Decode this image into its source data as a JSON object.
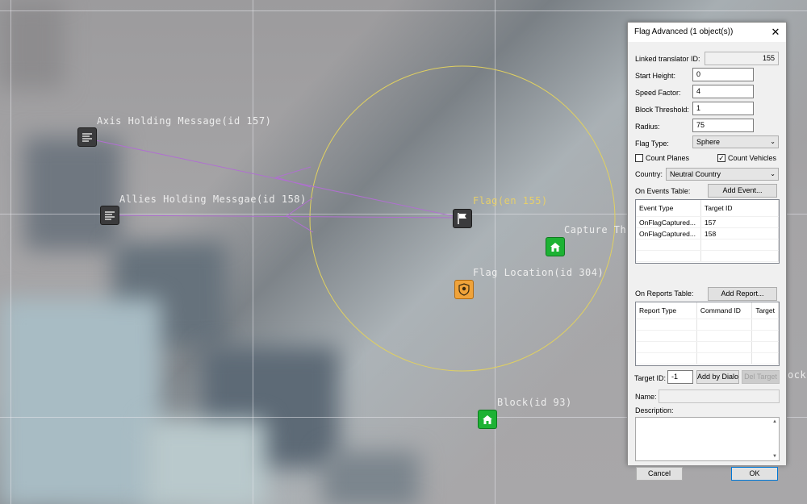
{
  "map": {
    "labels": {
      "axis_msg": "Axis Holding Message(id 157)",
      "allies_msg": "Allies Holding Messgae(id 158)",
      "flag": "Flag(en 155)",
      "capture": "Capture Th",
      "flag_location": "Flag Location(id 304)",
      "block": "Block(id 93)",
      "block_edge": "ock"
    },
    "icons": {
      "axis_msg": "message-icon",
      "allies_msg": "message-icon",
      "flag": "flag-icon",
      "capture": "house-icon",
      "flag_location": "shield-marker-icon",
      "block": "house-icon"
    },
    "colors": {
      "circle": "#e0d060",
      "links": "#b070d0",
      "label_yellow": "#e6cf6a"
    }
  },
  "dialog": {
    "title": "Flag Advanced (1 object(s))",
    "close_glyph": "✕",
    "linked_translator_label": "Linked translator ID:",
    "linked_translator_value": "155",
    "start_height_label": "Start Height:",
    "start_height_value": "0",
    "speed_factor_label": "Speed Factor:",
    "speed_factor_value": "4",
    "block_threshold_label": "Block Threshold:",
    "block_threshold_value": "1",
    "radius_label": "Radius:",
    "radius_value": "75",
    "flag_type_label": "Flag Type:",
    "flag_type_value": "Sphere",
    "count_planes_label": "Count Planes",
    "count_planes_checked": false,
    "count_vehicles_label": "Count Vehicles",
    "count_vehicles_checked": true,
    "check_glyph": "✓",
    "country_label": "Country:",
    "country_value": "Neutral Country",
    "on_events_label": "On Events Table:",
    "add_event_label": "Add Event...",
    "events_headers": [
      "Event Type",
      "Target ID"
    ],
    "events_rows": [
      [
        "OnFlagCaptured...",
        "157"
      ],
      [
        "OnFlagCaptured...",
        "158"
      ]
    ],
    "on_reports_label": "On Reports Table:",
    "add_report_label": "Add Report...",
    "reports_headers": [
      "Report Type",
      "Command ID",
      "Target"
    ],
    "target_id_label": "Target ID:",
    "target_id_value": "-1",
    "add_by_dialog_label": "Add by Dialog",
    "del_target_label": "Del Target",
    "name_label": "Name:",
    "name_value": "",
    "description_label": "Description:",
    "cancel_label": "Cancel",
    "ok_label": "OK"
  }
}
